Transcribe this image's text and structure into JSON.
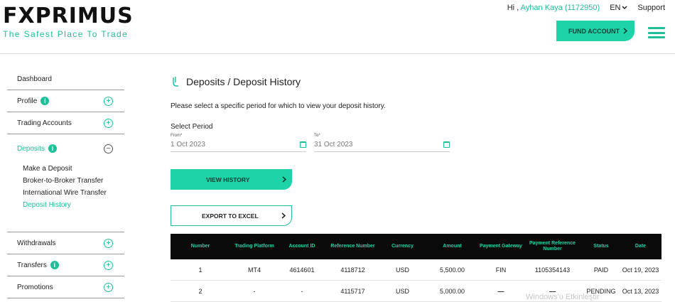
{
  "header": {
    "logo_text": "FXPRIMUS",
    "tagline": "The Safest Place To Trade",
    "greeting": "Hi ,",
    "user_name": "Ayhan Kaya (1172950)",
    "language": "EN",
    "support_label": "Support",
    "fund_account_label": "FUND ACCOUNT"
  },
  "sidebar": {
    "items": [
      {
        "label": "Dashboard"
      },
      {
        "label": "Profile",
        "badge": "i"
      },
      {
        "label": "Trading Accounts"
      },
      {
        "label": "Deposits",
        "badge": "i"
      },
      {
        "label": "Withdrawals"
      },
      {
        "label": "Transfers",
        "badge": "i"
      },
      {
        "label": "Promotions"
      }
    ],
    "deposit_submenu": [
      {
        "label": "Make a Deposit"
      },
      {
        "label": "Broker-to-Broker Transfer"
      },
      {
        "label": "International Wire Transfer"
      },
      {
        "label": "Deposit History"
      }
    ]
  },
  "main": {
    "title": "Deposits / Deposit History",
    "instructions": "Please select a specific period for which to view your deposit history.",
    "select_period_label": "Select Period",
    "from_label": "From*",
    "from_value": "1 Oct 2023",
    "to_label": "To*",
    "to_value": "31 Oct 2023",
    "view_history_label": "VIEW HISTORY",
    "export_label": "EXPORT TO EXCEL"
  },
  "table": {
    "headers": [
      "Number",
      "Trading Platform",
      "Account ID",
      "Reference Number",
      "Currency",
      "Amount",
      "Payment Gateway",
      "Payment Reference Number",
      "Status",
      "Date"
    ],
    "rows": [
      [
        "1",
        "MT4",
        "4614601",
        "4118712",
        "USD",
        "5,500.00",
        "FIN",
        "1105354143",
        "PAID",
        "Oct 19, 2023"
      ],
      [
        "2",
        "-",
        "-",
        "4115717",
        "USD",
        "5,000.00",
        "—",
        "—",
        "PENDING",
        "Oct 13, 2023"
      ]
    ]
  },
  "watermark": "Windows'u Etkinleştir",
  "colors": {
    "accent": "#1fd3a8",
    "accent_text": "#1fbf9a",
    "table_header_bg": "#0a0a0a"
  }
}
